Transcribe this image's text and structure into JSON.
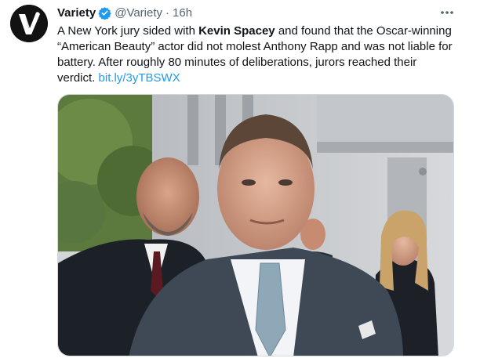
{
  "account": {
    "name": "Variety",
    "handle": "@Variety",
    "separator": "·",
    "time": "16h",
    "avatar_letter": "V",
    "verified_icon": "verified-badge",
    "brand_color": "#1d9bf0"
  },
  "tweet": {
    "text_1": "A New York jury sided with ",
    "text_bold": "Kevin Spacey",
    "text_2": " and found that the Oscar-winning “American Beauty” actor did not molest Anthony Rapp and was not liable for battery. After roughly 80 minutes of deliberations, jurors reached their verdict. ",
    "link_text": "bit.ly/3yTBSWX"
  },
  "media": {
    "type": "photo",
    "description_icon": "news-photo"
  },
  "menu": {
    "icon": "more-horizontal-icon"
  }
}
